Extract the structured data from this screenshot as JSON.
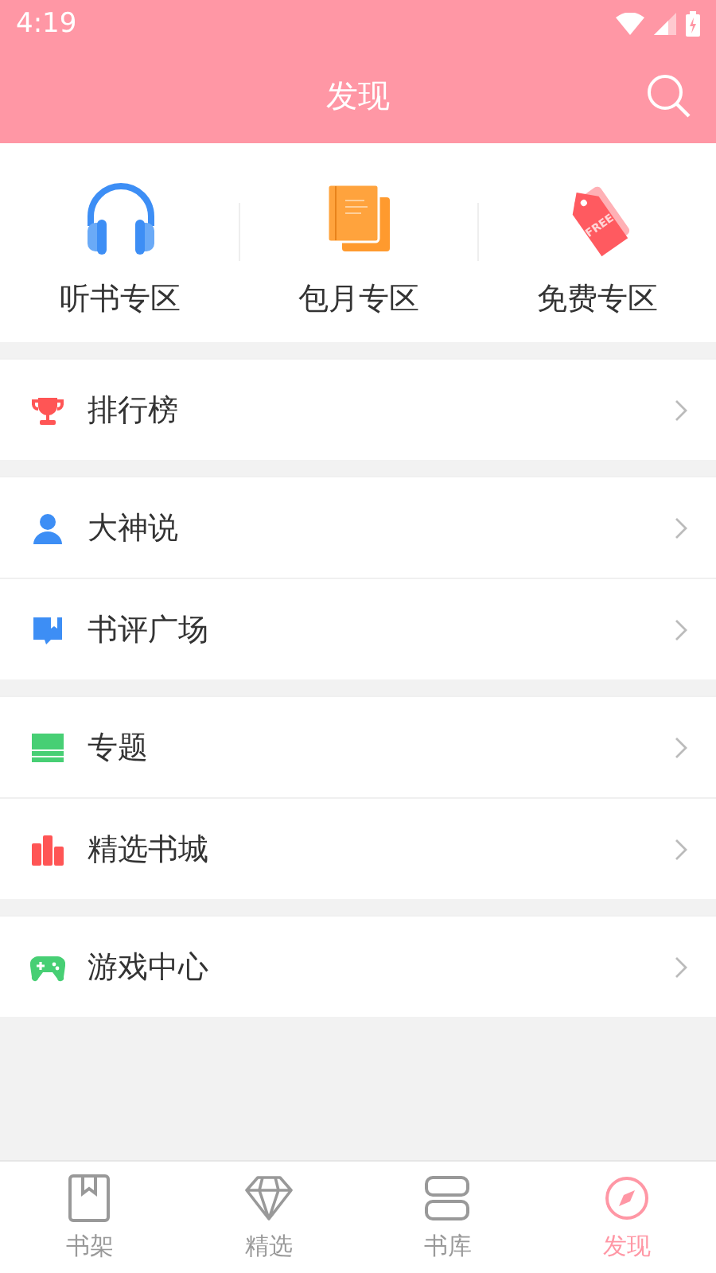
{
  "status_bar": {
    "time": "4:19"
  },
  "header": {
    "title": "发现"
  },
  "quick_links": [
    {
      "label": "听书专区",
      "kind": "headphones"
    },
    {
      "label": "包月专区",
      "kind": "books"
    },
    {
      "label": "免费专区",
      "kind": "tag",
      "icon_text": "FREE"
    }
  ],
  "sections": [
    {
      "items": [
        {
          "label": "排行榜",
          "kind": "trophy"
        }
      ]
    },
    {
      "items": [
        {
          "label": "大神说",
          "kind": "person"
        },
        {
          "label": "书评广场",
          "kind": "book"
        }
      ]
    },
    {
      "items": [
        {
          "label": "专题",
          "kind": "stack"
        },
        {
          "label": "精选书城",
          "kind": "shelf"
        }
      ]
    },
    {
      "items": [
        {
          "label": "游戏中心",
          "kind": "gamepad"
        }
      ]
    }
  ],
  "tab_bar": [
    {
      "label": "书架",
      "kind": "bookmark",
      "selected": false
    },
    {
      "label": "精选",
      "kind": "diamond",
      "selected": false
    },
    {
      "label": "书库",
      "kind": "blocks",
      "selected": false
    },
    {
      "label": "发现",
      "kind": "compass",
      "selected": true
    }
  ]
}
